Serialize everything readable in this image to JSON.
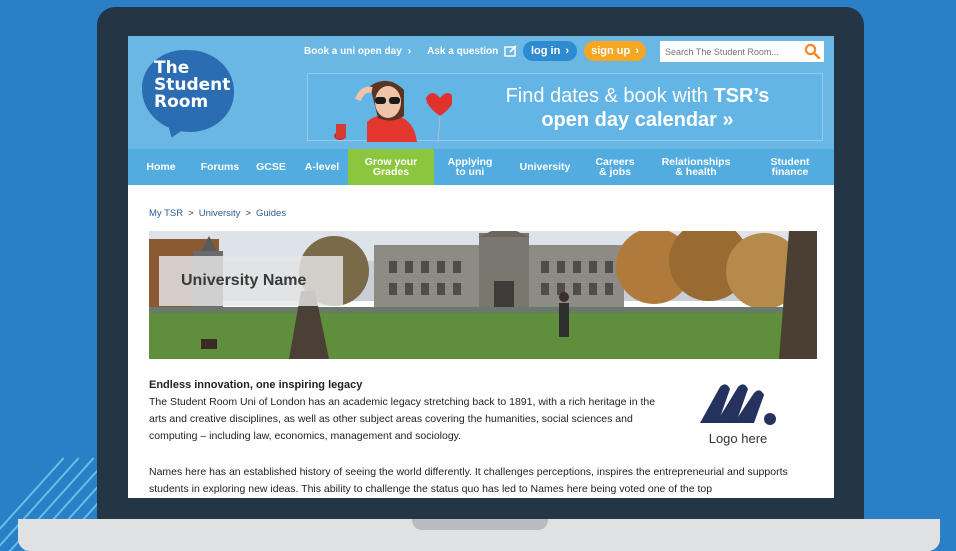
{
  "site": {
    "logo_line1": "The",
    "logo_line2": "Student",
    "logo_line3": "Room"
  },
  "toplinks": {
    "open_day": "Book a uni open day",
    "ask": "Ask a question"
  },
  "auth": {
    "login": "log in",
    "signup": "sign up"
  },
  "search": {
    "placeholder": "Search The Student Room..."
  },
  "banner": {
    "line1_plain": "Find dates & book with ",
    "line1_bold": "TSR’s",
    "line2": "open day calendar »"
  },
  "nav": [
    {
      "label": "Home"
    },
    {
      "label": "Forums"
    },
    {
      "label": "GCSE"
    },
    {
      "label": "A-level"
    },
    {
      "label": "Grow your\nGrades"
    },
    {
      "label": "Applying\nto uni"
    },
    {
      "label": "University"
    },
    {
      "label": "Careers\n& jobs"
    },
    {
      "label": "Relationships\n& health"
    },
    {
      "label": "Student\nfinance"
    }
  ],
  "breadcrumb": [
    "My TSR",
    "University",
    "Guides"
  ],
  "hero": {
    "title": "University Name"
  },
  "content": {
    "heading": "Endless innovation, one inspiring legacy",
    "para1": "The Student Room Uni  of  London has an academic legacy stretching back to 1891, with a rich heritage in the arts and creative disciplines, as well as other subject areas covering the humanities, social sciences and computing – including law, economics, management and sociology.",
    "para2": "Names here has an established history of seeing the world differently. It challenges perceptions, inspires the entrepreneurial and supports students in exploring new ideas. This ability to challenge the status quo has led to Names here being voted one of the top",
    "logo_label": "Logo here"
  },
  "colors": {
    "background": "#2a7fc6",
    "header": "#6ab7e3",
    "nav": "#52ace0",
    "nav_active": "#8cc63f",
    "signup": "#f5a623",
    "login": "#2e8bd0"
  }
}
